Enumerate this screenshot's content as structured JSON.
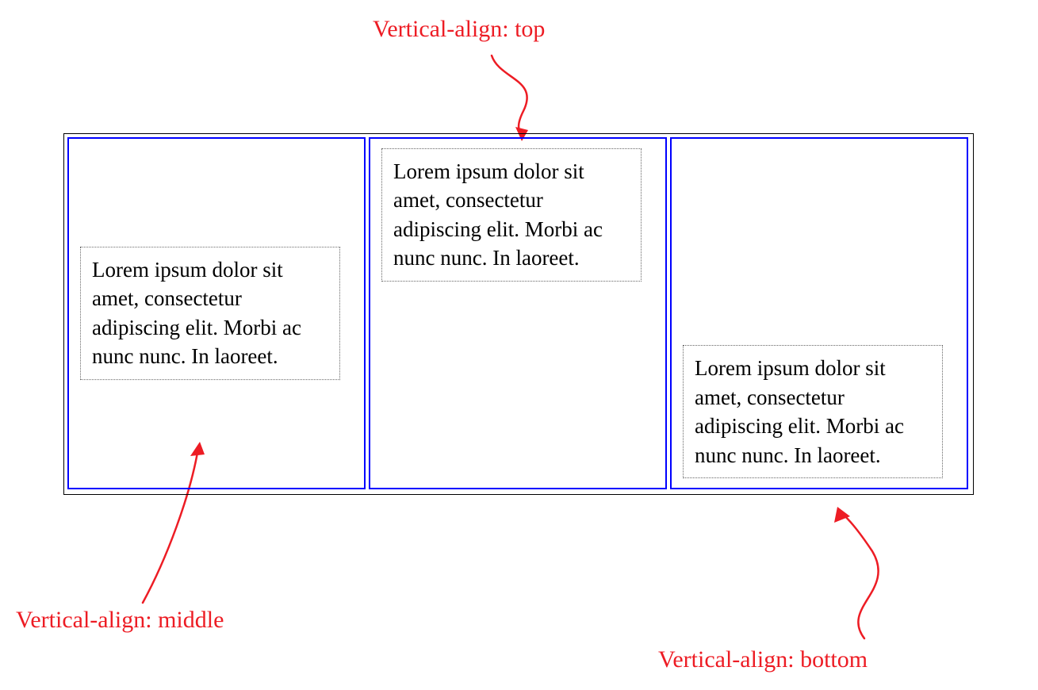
{
  "annotations": {
    "top": "Vertical-align: top",
    "middle": "Vertical-align: middle",
    "bottom": "Vertical-align: bottom"
  },
  "cells": {
    "left": "Lorem ipsum dolor sit amet, consectetur adipiscing elit. Morbi ac nunc nunc. In laoreet.",
    "center": "Lorem ipsum dolor sit amet, consectetur adipiscing elit. Morbi ac nunc nunc. In laoreet.",
    "right": "Lorem ipsum dolor sit amet, consectetur adipiscing elit. Morbi ac nunc nunc. In laoreet."
  },
  "colors": {
    "annotation": "#ed1c24",
    "cell_border": "#0000ff",
    "outer_border": "#000000",
    "inner_border": "#666666"
  }
}
